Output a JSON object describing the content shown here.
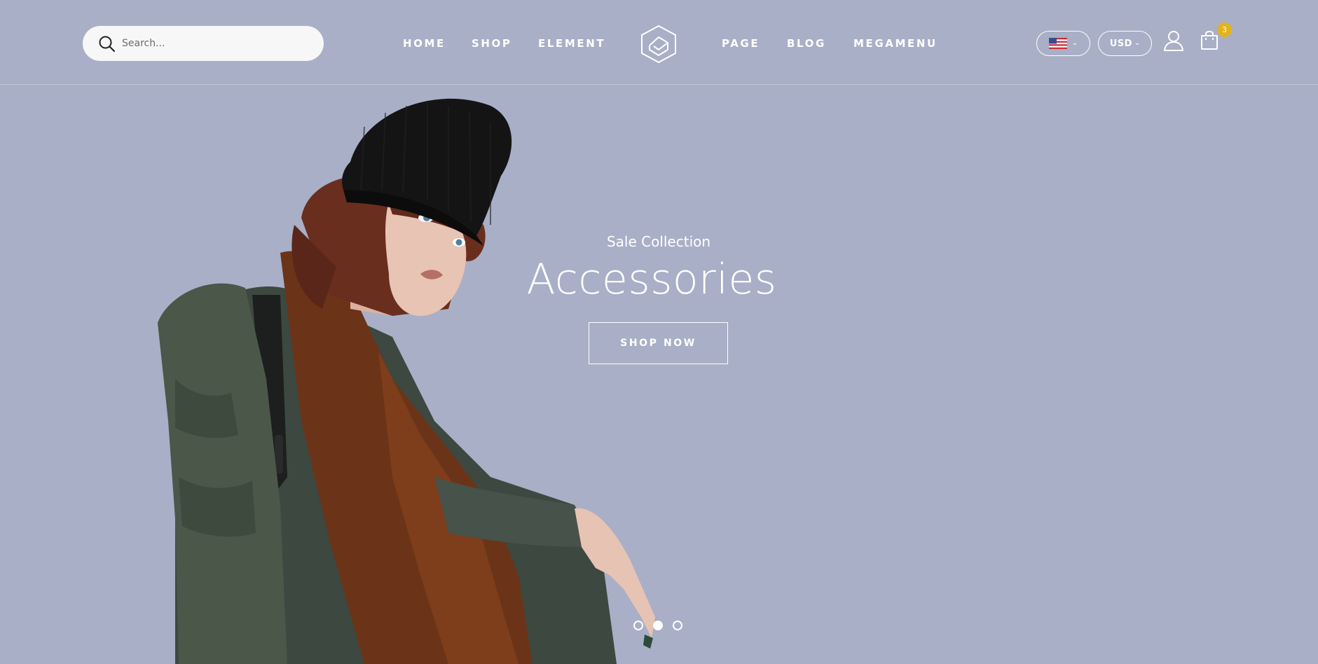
{
  "search": {
    "placeholder": "Search..."
  },
  "nav": {
    "left": [
      {
        "label": "HOME"
      },
      {
        "label": "SHOP"
      },
      {
        "label": "ELEMENT"
      }
    ],
    "right": [
      {
        "label": "PAGE"
      },
      {
        "label": "BLOG"
      },
      {
        "label": "MEGAMENU"
      }
    ]
  },
  "language": {
    "icon": "us-flag-icon"
  },
  "currency": {
    "label": "USD"
  },
  "cart": {
    "count": "3",
    "badge_color": "#e3b31f"
  },
  "hero": {
    "subtitle": "Sale Collection",
    "title": "Accessories",
    "button_label": "SHOP NOW",
    "background": "#a9afc6",
    "active_slide": 2,
    "slide_count": 3
  }
}
